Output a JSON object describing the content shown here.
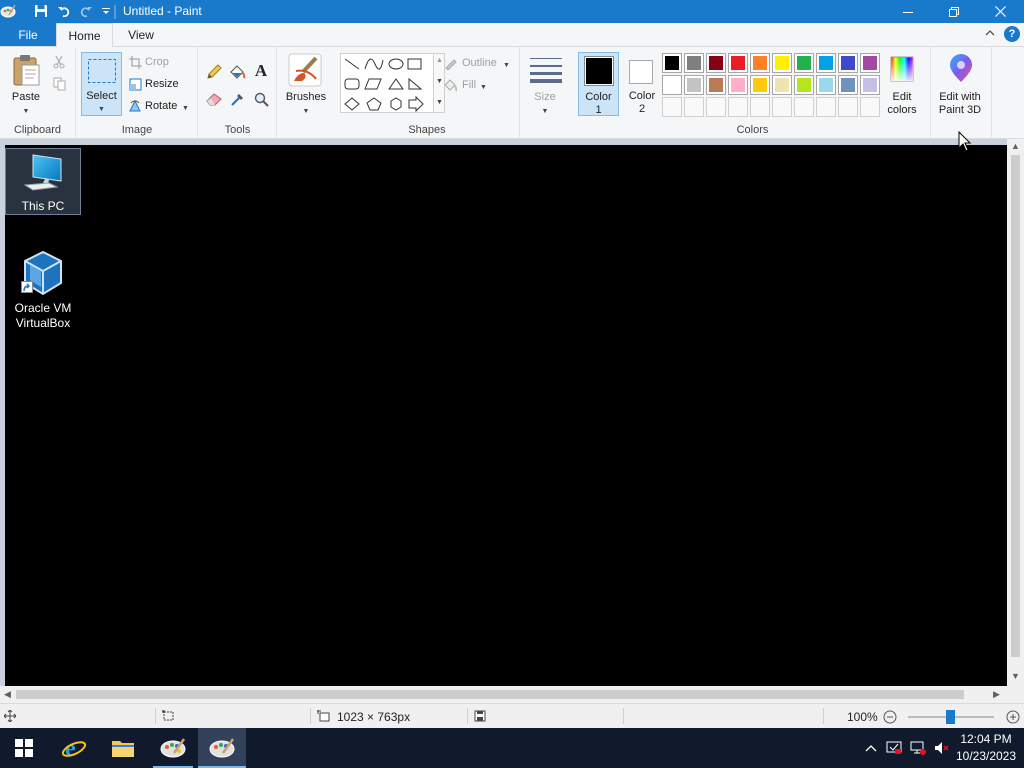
{
  "window": {
    "title": "Untitled - Paint",
    "buttons": [
      "minimize",
      "restore",
      "close"
    ]
  },
  "tabs": {
    "file": "File",
    "home": "Home",
    "view": "View"
  },
  "ribbon": {
    "clipboard": {
      "group": "Clipboard",
      "paste": "Paste"
    },
    "image": {
      "group": "Image",
      "select": "Select",
      "crop": "Crop",
      "resize": "Resize",
      "rotate": "Rotate"
    },
    "tools": {
      "group": "Tools"
    },
    "brushes": {
      "label": "Brushes"
    },
    "shapes": {
      "group": "Shapes",
      "outline": "Outline",
      "fill": "Fill"
    },
    "size": {
      "label": "Size"
    },
    "colors": {
      "group": "Colors",
      "color1_line1": "Color",
      "color1_line2": "1",
      "color2_line1": "Color",
      "color2_line2": "2",
      "edit_line1": "Edit",
      "edit_line2": "colors",
      "color1_value": "#000000",
      "color2_value": "#ffffff",
      "palette_row1": [
        "#000000",
        "#7f7f7f",
        "#880015",
        "#ed1c24",
        "#ff7f27",
        "#fff200",
        "#22b14c",
        "#00a2e8",
        "#3f48cc",
        "#a349a4"
      ],
      "palette_row2": [
        "#ffffff",
        "#c3c3c3",
        "#b97a57",
        "#ffaec9",
        "#ffc90e",
        "#efe4b0",
        "#b5e61d",
        "#99d9ea",
        "#7092be",
        "#c8bfe7"
      ],
      "palette_row3_empty": 10
    },
    "paint3d": {
      "line1": "Edit with",
      "line2": "Paint 3D"
    }
  },
  "canvas": {
    "desktop_icons": [
      {
        "label": "This PC",
        "selected": true
      },
      {
        "label_line1": "Oracle VM",
        "label_line2": "VirtualBox",
        "selected": false
      }
    ]
  },
  "status": {
    "dimensions": "1023 × 763px",
    "zoom": "100%"
  },
  "taskbar": {
    "time": "12:04 PM",
    "date": "10/23/2023",
    "apps": [
      "start",
      "internet-explorer",
      "file-explorer",
      "paint-task",
      "paint-active"
    ]
  }
}
